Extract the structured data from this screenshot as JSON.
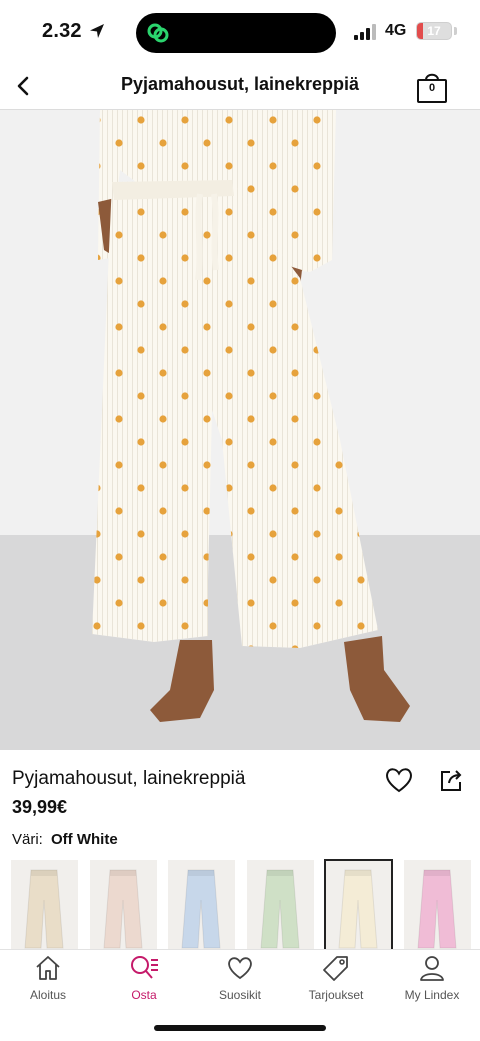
{
  "status_bar": {
    "time": "2.32",
    "network": "4G",
    "battery_percent": "17",
    "battery_level": 0.17,
    "battery_color": "#e24c4c"
  },
  "header": {
    "title": "Pyjamahousut, lainekreppiä",
    "bag_count": "0"
  },
  "gallery": {
    "image_count": 7,
    "active_index": 0
  },
  "product": {
    "name": "Pyjamahousut, lainekreppiä",
    "price": "39,99€",
    "color_label": "Väri:",
    "color_value": "Off White",
    "swatches": [
      {
        "color": "#e9ddc8",
        "selected": false
      },
      {
        "color": "#ecd9cf",
        "selected": false
      },
      {
        "color": "#c7d7ea",
        "selected": false
      },
      {
        "color": "#cfe0c6",
        "selected": false
      },
      {
        "color": "#f4ecd6",
        "selected": true
      },
      {
        "color": "#f0bcd6",
        "selected": false
      }
    ]
  },
  "bottom_nav": {
    "active_color": "#c51a6a",
    "items": [
      {
        "label": "Aloitus",
        "icon": "home-icon"
      },
      {
        "label": "Osta",
        "icon": "search-list-icon",
        "active": true
      },
      {
        "label": "Suosikit",
        "icon": "heart-icon"
      },
      {
        "label": "Tarjoukset",
        "icon": "tag-icon"
      },
      {
        "label": "My Lindex",
        "icon": "user-icon"
      }
    ]
  }
}
